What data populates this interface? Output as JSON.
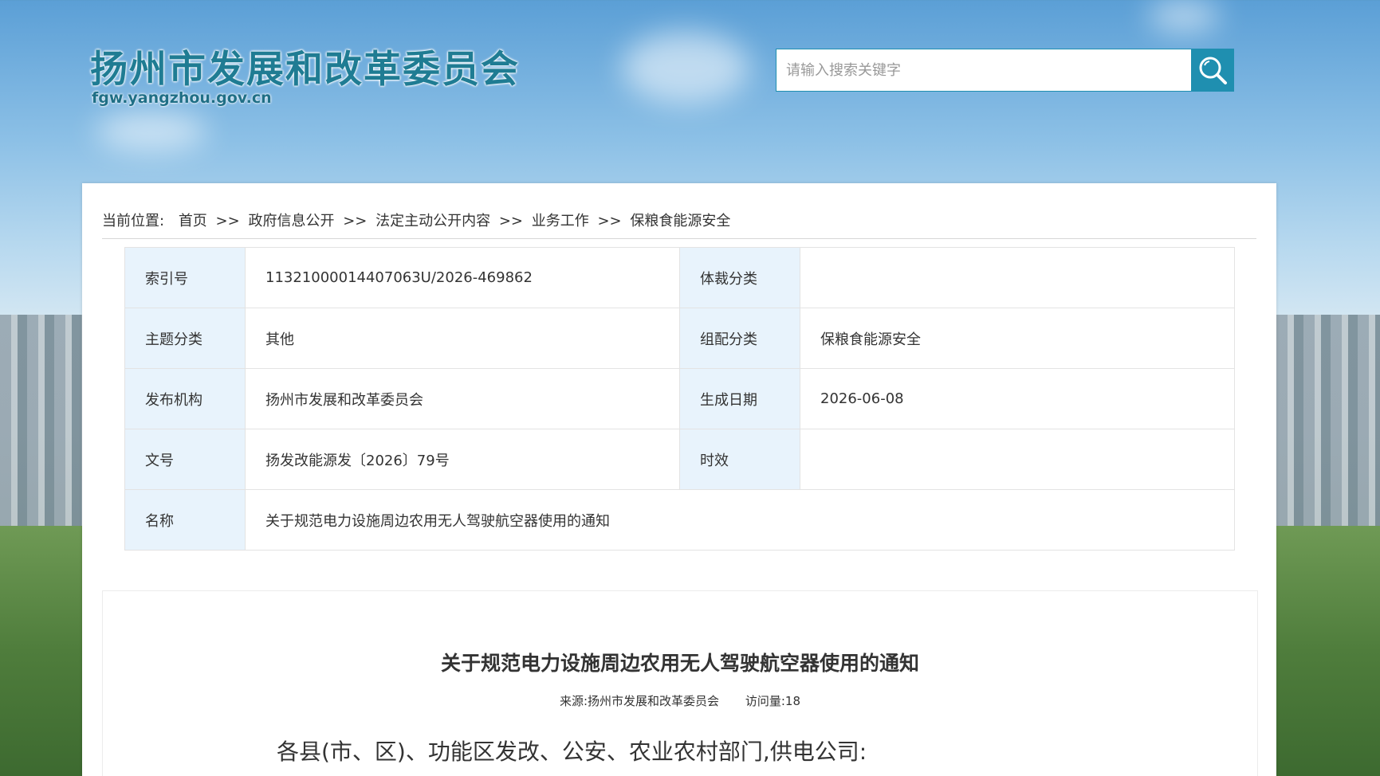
{
  "header": {
    "site_title": "扬州市发展和改革委员会",
    "site_url": "fgw.yangzhou.gov.cn",
    "search_placeholder": "请输入搜索关键字"
  },
  "breadcrumb": {
    "prefix": "当前位置:",
    "items": [
      "首页",
      "政府信息公开",
      "法定主动公开内容",
      "业务工作",
      "保粮食能源安全"
    ],
    "separator": ">>"
  },
  "meta": {
    "index_label": "索引号",
    "index_value": "11321000014407063U/2026-469862",
    "genre_label": "体裁分类",
    "genre_value": "",
    "topic_label": "主题分类",
    "topic_value": "其他",
    "group_label": "组配分类",
    "group_value": "保粮食能源安全",
    "issuer_label": "发布机构",
    "issuer_value": "扬州市发展和改革委员会",
    "date_label": "生成日期",
    "date_value": "2026-06-08",
    "docno_label": "文号",
    "docno_value": "扬发改能源发〔2026〕79号",
    "validity_label": "时效",
    "validity_value": "",
    "name_label": "名称",
    "name_value": "关于规范电力设施周边农用无人驾驶航空器使用的通知"
  },
  "article": {
    "title": "关于规范电力设施周边农用无人驾驶航空器使用的通知",
    "source": "来源:扬州市发展和改革委员会",
    "visits": "访问量:18",
    "first_line": "各县(市、区)、功能区发改、公安、农业农村部门,供电公司:"
  },
  "colors": {
    "accent": "#1f8fb0",
    "label_bg": "#e8f3fc"
  }
}
